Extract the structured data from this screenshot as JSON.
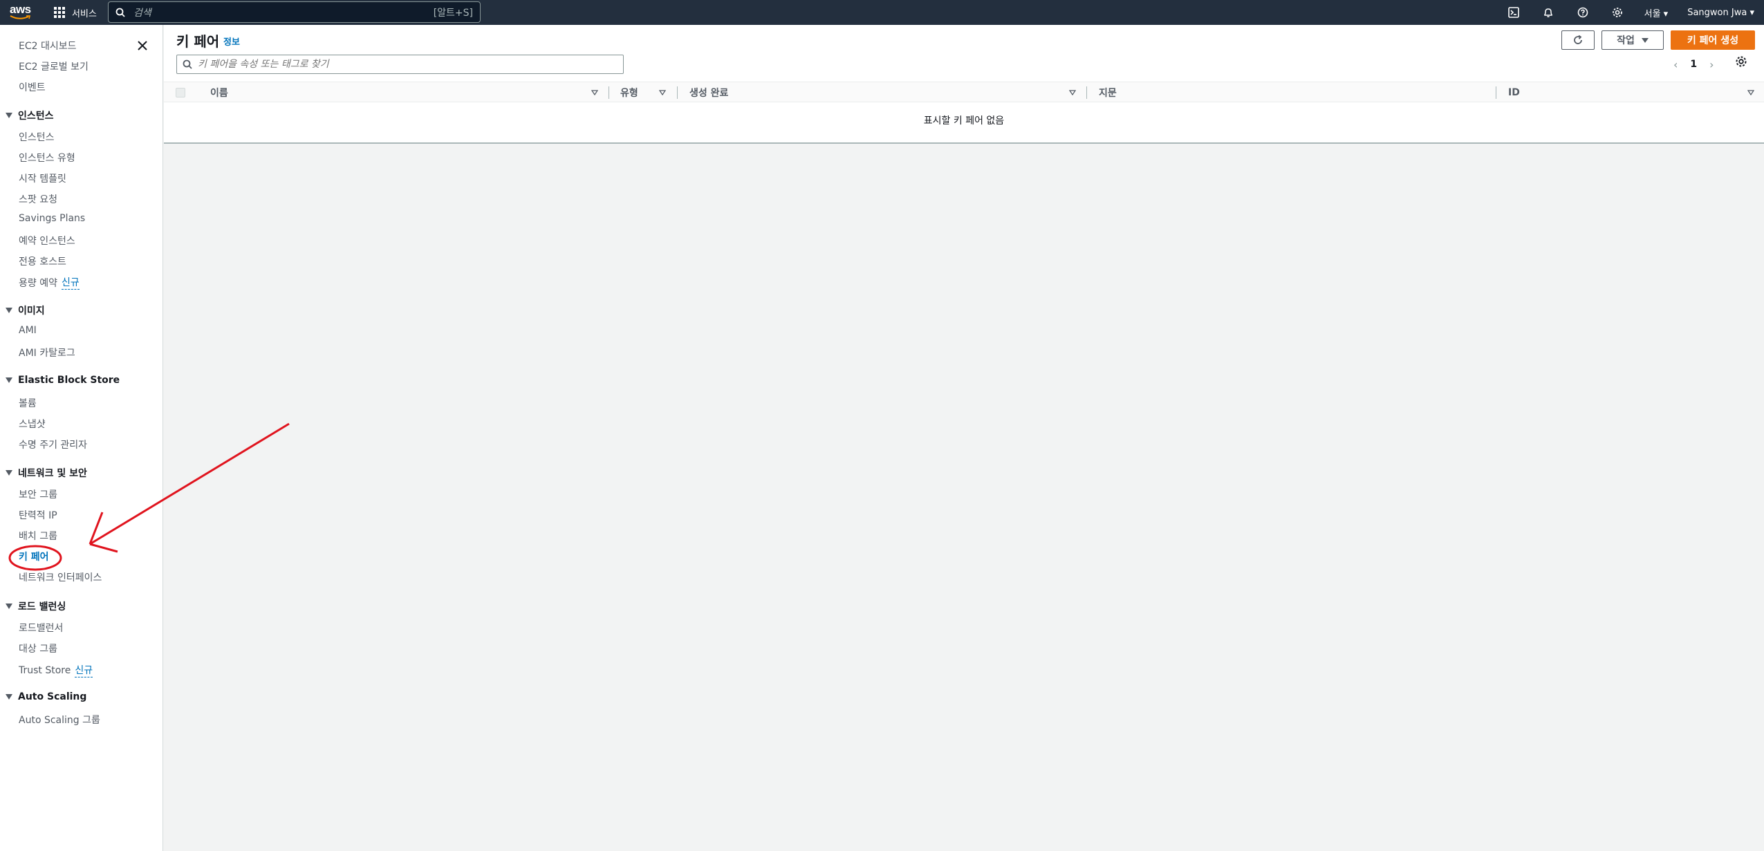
{
  "topnav": {
    "logo": "aws",
    "services_label": "서비스",
    "search_placeholder": "검색",
    "search_shortcut": "[알트+S]",
    "region": "서울",
    "user": "Sangwon Jwa",
    "icons": [
      "terminal-icon",
      "bell-icon",
      "help-icon",
      "gear-icon"
    ]
  },
  "sidebar": {
    "top_items": [
      "EC2 대시보드",
      "EC2 글로벌 보기",
      "이벤트"
    ],
    "sections": [
      {
        "title": "인스턴스",
        "items": [
          "인스턴스",
          "인스턴스 유형",
          "시작 템플릿",
          "스팟 요청",
          "Savings Plans",
          "예약 인스턴스",
          "전용 호스트",
          "용량 예약"
        ]
      },
      {
        "title": "이미지",
        "items": [
          "AMI",
          "AMI 카탈로그"
        ]
      },
      {
        "title": "Elastic Block Store",
        "items": [
          "볼륨",
          "스냅샷",
          "수명 주기 관리자"
        ]
      },
      {
        "title": "네트워크 및 보안",
        "items": [
          "보안 그룹",
          "탄력적 IP",
          "배치 그룹",
          "키 페어",
          "네트워크 인터페이스"
        ]
      },
      {
        "title": "로드 밸런싱",
        "items": [
          "로드밸런서",
          "대상 그룹",
          "Trust Store"
        ]
      },
      {
        "title": "Auto Scaling",
        "items": [
          "Auto Scaling 그룹"
        ]
      }
    ],
    "new_badge": "신규"
  },
  "main": {
    "title": "키 페어",
    "info": "정보",
    "filter_placeholder": "키 페어을 속성 또는 태그로 찾기",
    "actions_label": "작업",
    "create_label": "키 페어 생성",
    "page_number": "1",
    "columns": [
      "이름",
      "유형",
      "생성 완료",
      "지문",
      "ID"
    ],
    "empty_message": "표시할 키 페어 없음"
  },
  "colors": {
    "nav_bg": "#232f3e",
    "primary_button": "#ec7211",
    "link": "#0073bb",
    "annotation": "#e0141e"
  }
}
